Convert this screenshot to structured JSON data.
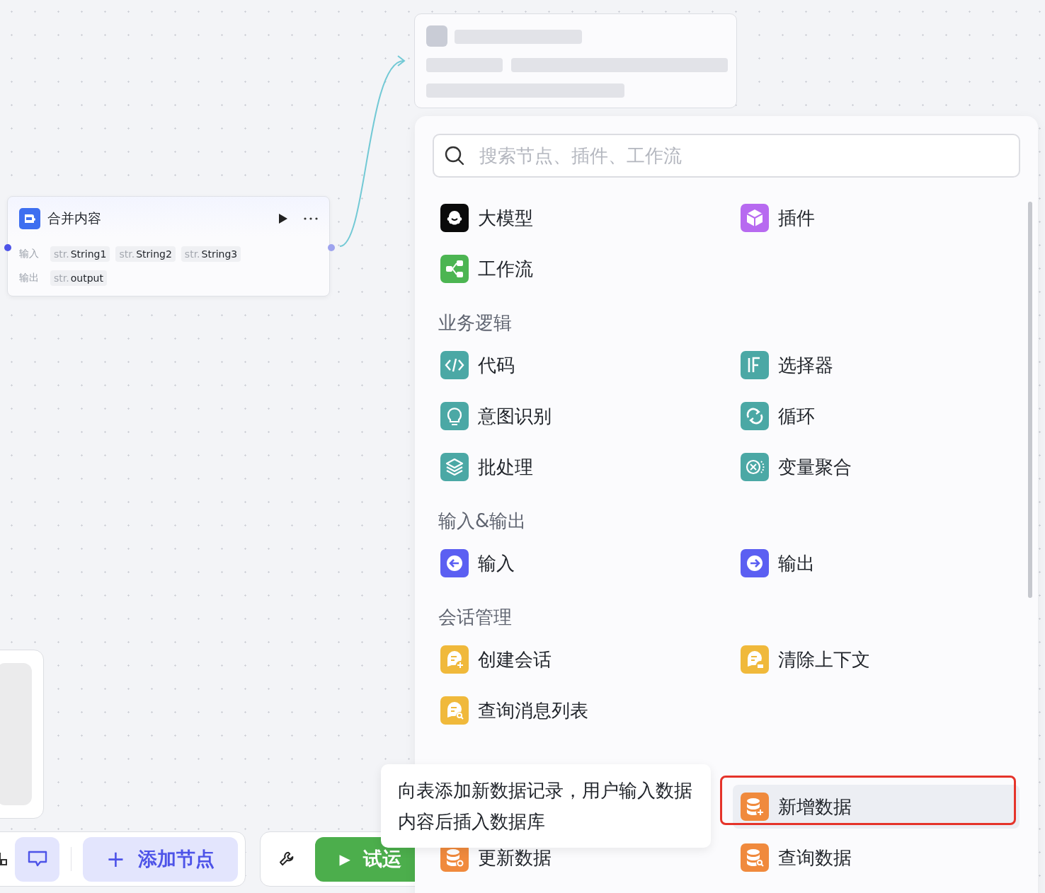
{
  "node": {
    "title": "合并内容",
    "inputs_label": "输入",
    "inputs": [
      {
        "type": "str.",
        "name": "String1"
      },
      {
        "type": "str.",
        "name": "String2"
      },
      {
        "type": "str.",
        "name": "String3"
      }
    ],
    "outputs_label": "输出",
    "outputs": [
      {
        "type": "str.",
        "name": "output"
      }
    ]
  },
  "panel": {
    "search": {
      "placeholder": "搜索节点、插件、工作流"
    },
    "sections": [
      {
        "items": [
          {
            "label": "大模型",
            "color": "#0a0a0a",
            "hovered": false,
            "marked": false
          },
          {
            "label": "插件",
            "color": "#b76af0",
            "hovered": false,
            "marked": false
          },
          {
            "label": "工作流",
            "color": "#4cb552",
            "hovered": false,
            "marked": false
          }
        ]
      },
      {
        "title": "业务逻辑",
        "items": [
          {
            "label": "代码",
            "color": "#4ba8a5",
            "hovered": false,
            "marked": false
          },
          {
            "label": "选择器",
            "color": "#4ba8a5",
            "hovered": false,
            "marked": false
          },
          {
            "label": "意图识别",
            "color": "#4ba8a5",
            "hovered": false,
            "marked": false
          },
          {
            "label": "循环",
            "color": "#4ba8a5",
            "hovered": false,
            "marked": false
          },
          {
            "label": "批处理",
            "color": "#4ba8a5",
            "hovered": false,
            "marked": false
          },
          {
            "label": "变量聚合",
            "color": "#4ba8a5",
            "hovered": false,
            "marked": false
          }
        ]
      },
      {
        "title": "输入&输出",
        "items": [
          {
            "label": "输入",
            "color": "#5b5ff2",
            "hovered": false,
            "marked": false
          },
          {
            "label": "输出",
            "color": "#5b5ff2",
            "hovered": false,
            "marked": false
          }
        ]
      },
      {
        "title": "会话管理",
        "items": [
          {
            "label": "创建会话",
            "color": "#f0b93b",
            "hovered": false,
            "marked": false
          },
          {
            "label": "清除上下文",
            "color": "#f0b93b",
            "hovered": false,
            "marked": false
          },
          {
            "label": "查询消息列表",
            "color": "#f0b93b",
            "hovered": false,
            "marked": false
          }
        ]
      },
      {
        "items": [
          {
            "label": "新增数据",
            "color": "#f08a3d",
            "hovered": true,
            "marked": true
          },
          {
            "label": "更新数据",
            "color": "#f08a3d",
            "hovered": false,
            "marked": false
          },
          {
            "label": "查询数据",
            "color": "#f08a3d",
            "hovered": false,
            "marked": false
          }
        ]
      }
    ]
  },
  "tooltip": "向表添加新数据记录，用户输入数据内容后插入数据库",
  "toolbar": {
    "add_node": "添加节点",
    "add_icon": "+",
    "run": "试运",
    "run_icon": "▶"
  }
}
